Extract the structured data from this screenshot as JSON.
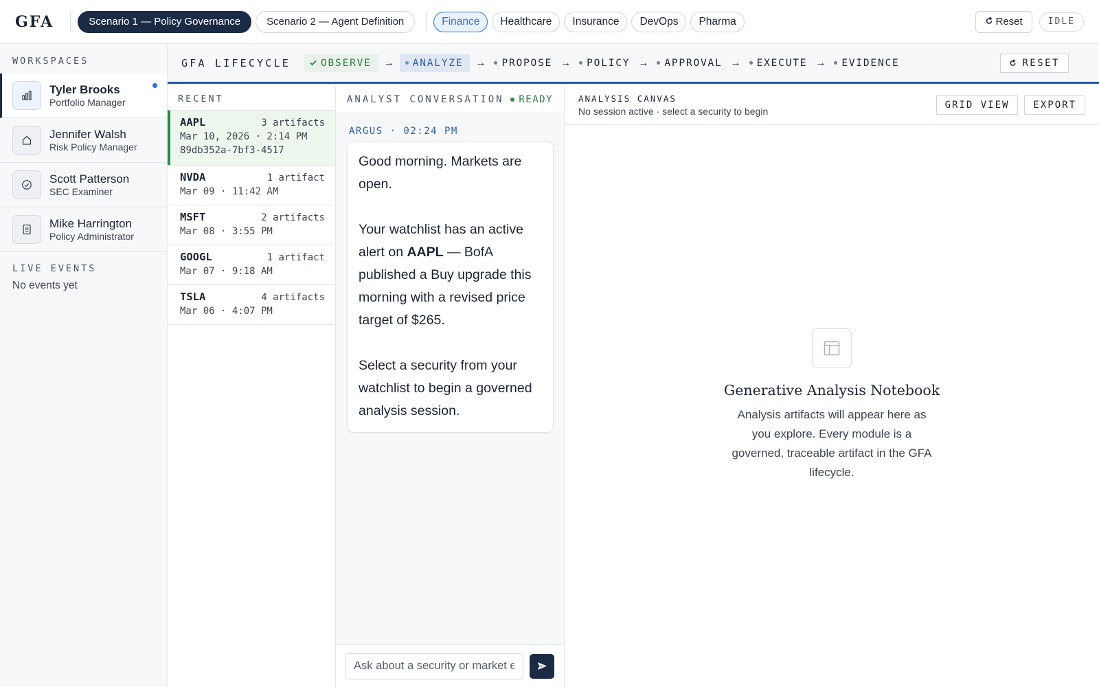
{
  "app": {
    "logo": "GFA",
    "scenarios": [
      "Scenario 1 — Policy Governance",
      "Scenario 2 — Agent Definition"
    ],
    "domains": [
      "Finance",
      "Healthcare",
      "Insurance",
      "DevOps",
      "Pharma"
    ],
    "reset_label": "Reset",
    "status": "IDLE"
  },
  "sidebar": {
    "workspaces_title": "WORKSPACES",
    "workspaces": [
      {
        "name": "Tyler Brooks",
        "role": "Portfolio Manager",
        "icon": "bar-chart-icon"
      },
      {
        "name": "Jennifer Walsh",
        "role": "Risk Policy Manager",
        "icon": "home-icon"
      },
      {
        "name": "Scott Patterson",
        "role": "SEC Examiner",
        "icon": "check-circle-icon"
      },
      {
        "name": "Mike Harrington",
        "role": "Policy Administrator",
        "icon": "document-icon"
      }
    ],
    "live_events_title": "LIVE EVENTS",
    "live_events_empty": "No events yet"
  },
  "lifecycle": {
    "label": "GFA LIFECYCLE",
    "steps": [
      "OBSERVE",
      "ANALYZE",
      "PROPOSE",
      "POLICY",
      "APPROVAL",
      "EXECUTE",
      "EVIDENCE"
    ],
    "completed_step": "OBSERVE",
    "current_step": "ANALYZE",
    "reset_label": "RESET"
  },
  "recent": {
    "title": "RECENT",
    "items": [
      {
        "ticker": "AAPL",
        "count": "3 artifacts",
        "date": "Mar 10, 2026 · 2:14 PM",
        "id": "89db352a-7bf3-4517"
      },
      {
        "ticker": "NVDA",
        "count": "1 artifact",
        "date": "Mar 09 · 11:42 AM"
      },
      {
        "ticker": "MSFT",
        "count": "2 artifacts",
        "date": "Mar 08 · 3:55 PM"
      },
      {
        "ticker": "GOOGL",
        "count": "1 artifact",
        "date": "Mar 07 · 9:18 AM"
      },
      {
        "ticker": "TSLA",
        "count": "4 artifacts",
        "date": "Mar 06 · 4:07 PM"
      }
    ]
  },
  "conversation": {
    "title": "ANALYST CONVERSATION",
    "status": "READY",
    "message_meta": "ARGUS · 02:24 PM",
    "message": {
      "p1": "Good morning. Markets are open.",
      "p2_before": "Your watchlist has an active alert on ",
      "p2_bold": "AAPL",
      "p2_after": " — BofA published a Buy upgrade this morning with a revised price target of $265.",
      "p3": "Select a security from your watchlist to begin a governed analysis session."
    },
    "input_placeholder": "Ask about a security or market events..."
  },
  "canvas": {
    "title": "ANALYSIS CANVAS",
    "subtitle": "No session active · select a security to begin",
    "grid_view_label": "GRID VIEW",
    "export_label": "EXPORT",
    "empty_title": "Generative Analysis Notebook",
    "empty_text": "Analysis artifacts will appear here as you explore. Every module is a governed, traceable artifact in the GFA lifecycle."
  },
  "colors": {
    "navy": "#1c2b45",
    "accent_blue": "#2f6fde",
    "success_green": "#2e8b47",
    "lifecycle_border": "#2457a8"
  }
}
